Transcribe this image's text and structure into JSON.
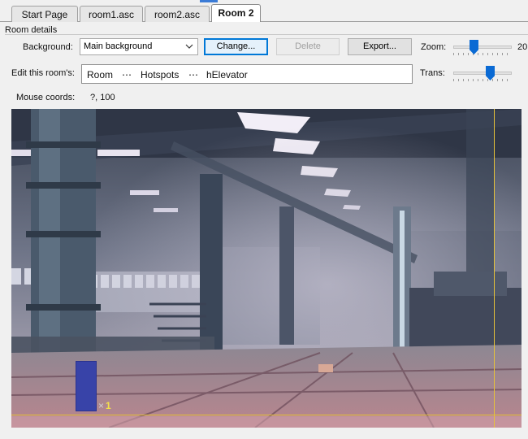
{
  "tabs": [
    {
      "label": "Start Page",
      "active": false
    },
    {
      "label": "room1.asc",
      "active": false
    },
    {
      "label": "room2.asc",
      "active": false
    },
    {
      "label": "Room 2",
      "active": true
    }
  ],
  "room_details": {
    "group_label": "Room details",
    "background_label": "Background:",
    "background_value": "Main background",
    "change_button": "Change...",
    "delete_button": "Delete",
    "export_button": "Export...",
    "zoom_label": "Zoom:",
    "zoom_value": "20",
    "zoom_level": 0.33,
    "trans_label": "Trans:",
    "trans_level": 0.65,
    "edit_label": "Edit this room's:",
    "edit_path": [
      "Room",
      "Hotspots",
      "hElevator"
    ],
    "separator": "⋯",
    "mouse_coords_label": "Mouse coords:",
    "mouse_coords_value": "?, 100"
  },
  "canvas": {
    "hotspot_number": "1",
    "guide_color": "#e6c23a",
    "hotspot_color": "#3843a8"
  }
}
